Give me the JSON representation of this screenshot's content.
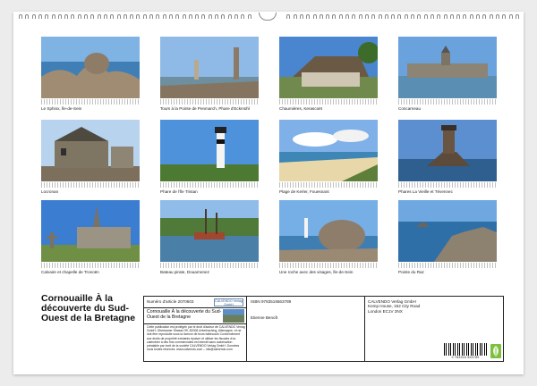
{
  "calendar": {
    "title": "Cornouaille À la découverte du Sud-Ouest de la Bretagne",
    "photos": [
      {
        "caption": "Le Sphinx, Île-de-Sein",
        "scene": "rocks-sea"
      },
      {
        "caption": "Tours à la Pointe de Penmarch, Phare d'Eckmühl",
        "scene": "lighthouse-rocks"
      },
      {
        "caption": "Chaumières, Kerascoët",
        "scene": "thatched-cottage"
      },
      {
        "caption": "Concarneau",
        "scene": "walled-town"
      },
      {
        "caption": "Locronan",
        "scene": "stone-houses"
      },
      {
        "caption": "Phare de l'Île Tristan",
        "scene": "lighthouse-green"
      },
      {
        "caption": "Plage de Kerler, Fouesnant",
        "scene": "beach"
      },
      {
        "caption": "Phares La Vieille et Tévennec",
        "scene": "lighthouse-sea"
      },
      {
        "caption": "Calvaire et chapelle de Tronoën",
        "scene": "chapel"
      },
      {
        "caption": "Bateau pirate, Douarnenez",
        "scene": "harbour"
      },
      {
        "caption": "Une roche avec des visages, Île-de-Sein",
        "scene": "boulder"
      },
      {
        "caption": "Pointe du Raz",
        "scene": "cliffs"
      }
    ]
  },
  "info": {
    "article_label": "Numéro d'article 2070603",
    "logo_text": "CALVENDO Verlag GmbH",
    "subtitle": "Cornouaille À la découverte du Sud-Ouest de la Bretagne",
    "legal": "Cette publication est protégée par le droit d'auteur de CALVENDO Verlag GmbH, Oberkamer Strasse 99, 82008 Unterhaching, Allemagne, et ne doit être reproduite sous la licence de leurs ballecouls Conformément aux droits de propriété existants épuiser et utiliser les fiscales d'un calendrier à des fins commerciales est interdit sans autorisation préalable par écrit de la société CALVENDO Verlag GmbH. Données sous toutes réserves. www.calvendo.com – info@calvendo.com",
    "isbn": "ISBN 9783516563789",
    "author": "Etienne Benoît",
    "publisher_lines": [
      "CALVENDO Verlag GmbH",
      "Kemp House, 152 City Road",
      "London EC1V 2NX"
    ],
    "barcode_number": "9 783516 563789"
  },
  "colors": {
    "sky": "#4a8fd8",
    "sea": "#2f6fa8",
    "grass": "#5e7f3a",
    "stone": "#9a8f7e",
    "sand": "#e3d2a4"
  }
}
